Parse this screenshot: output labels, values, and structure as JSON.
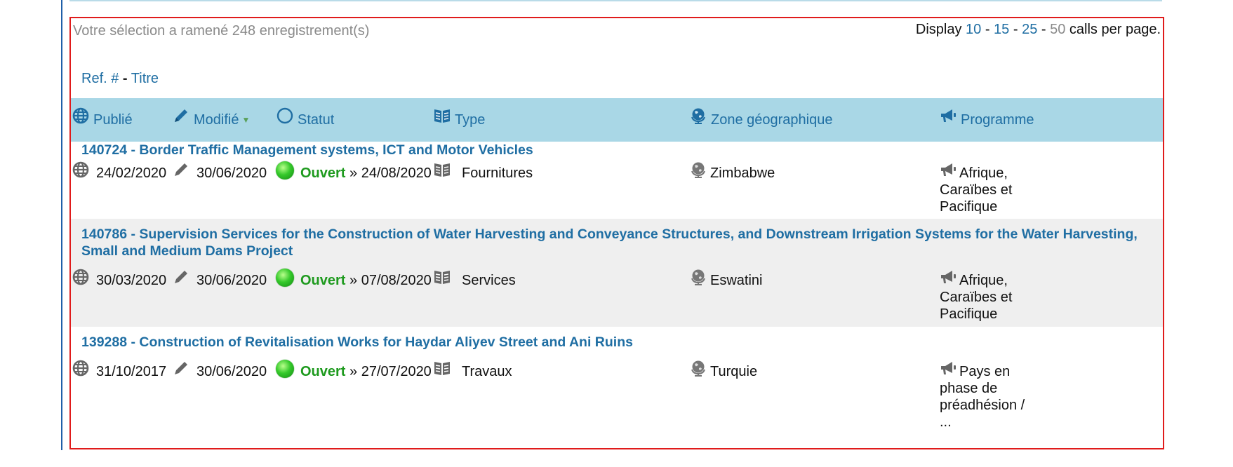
{
  "results": {
    "count_text": "Votre sélection a ramené 248 enregistrement(s)",
    "display_prefix": "Display",
    "page_sizes": [
      "10",
      "15",
      "25",
      "50"
    ],
    "current_page_size": "50",
    "display_suffix": "calls per page."
  },
  "sort": {
    "ref": "Ref. #",
    "sep": "-",
    "title": "Titre"
  },
  "columns": {
    "published": "Publié",
    "modified": "Modifié",
    "status": "Statut",
    "type": "Type",
    "zone": "Zone géographique",
    "programme": "Programme"
  },
  "colors": {
    "link": "#1f6ea3",
    "header_bg": "#a9d7e6",
    "status_open": "#1e9a1e",
    "frame_border": "#e01b1b"
  },
  "items": [
    {
      "title": "140724 - Border Traffic Management systems, ICT and Motor Vehicles",
      "published": "24/02/2020",
      "modified": "30/06/2020",
      "status": "Ouvert",
      "deadline": "» 24/08/2020",
      "type": "Fournitures",
      "zone": "Zimbabwe",
      "programme": "Afrique, Caraïbes et Pacifique"
    },
    {
      "title": "140786 - Supervision Services for the Construction of Water Harvesting and Conveyance Structures, and Downstream Irrigation Systems for the Water Harvesting, Small and Medium Dams Project",
      "published": "30/03/2020",
      "modified": "30/06/2020",
      "status": "Ouvert",
      "deadline": "» 07/08/2020",
      "type": "Services",
      "zone": "Eswatini",
      "programme": "Afrique, Caraïbes et Pacifique"
    },
    {
      "title": "139288 - Construction of Revitalisation Works for Haydar Aliyev Street and Ani Ruins",
      "published": "31/10/2017",
      "modified": "30/06/2020",
      "status": "Ouvert",
      "deadline": "» 27/07/2020",
      "type": "Travaux",
      "zone": "Turquie",
      "programme": "Pays en phase de préadhésion / ..."
    }
  ]
}
